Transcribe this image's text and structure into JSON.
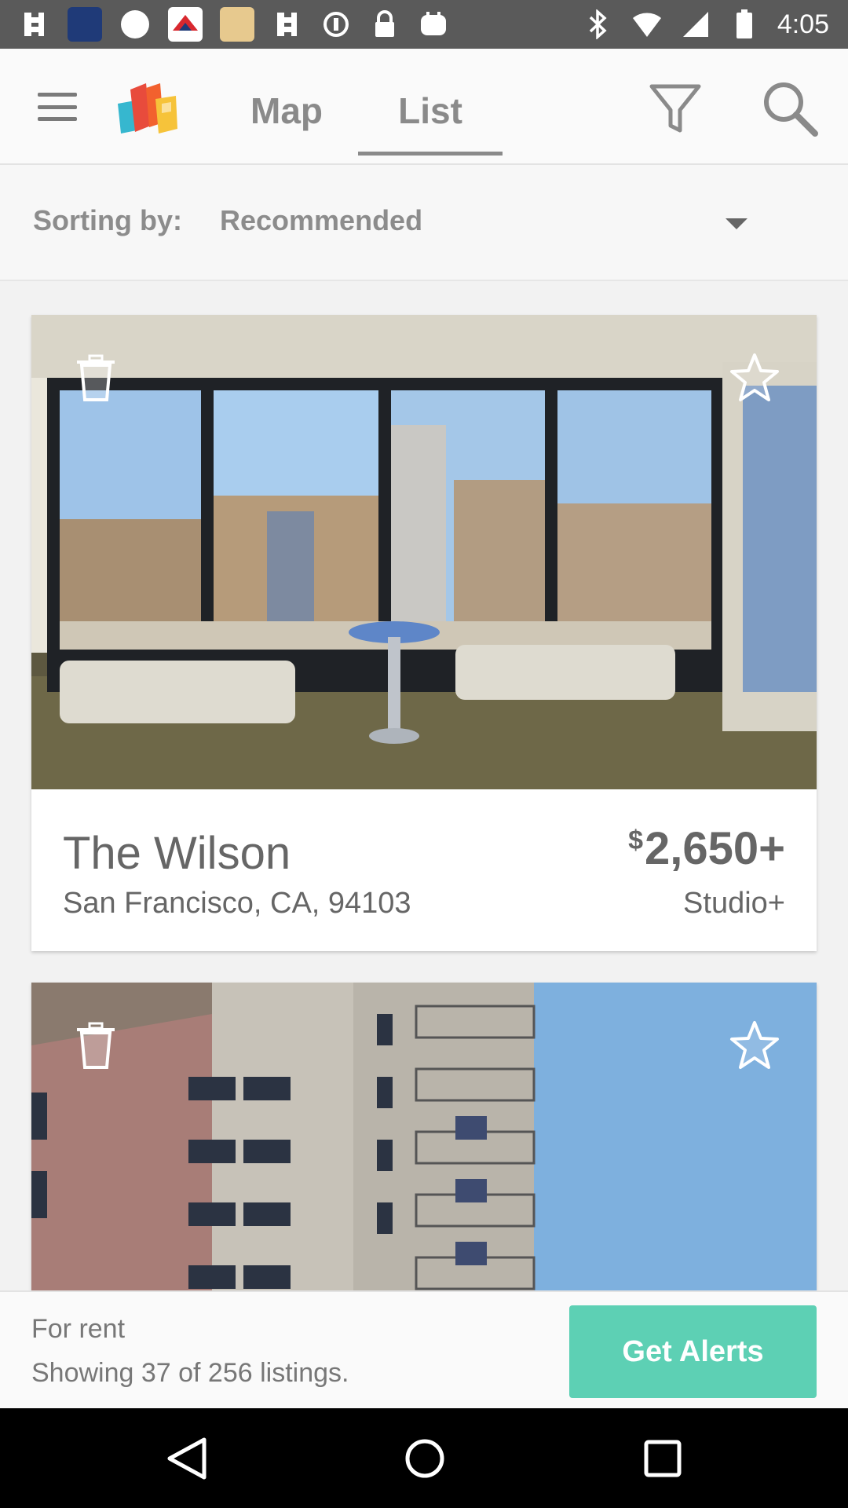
{
  "status_bar": {
    "time": "4:05"
  },
  "header": {
    "tabs": [
      {
        "label": "Map",
        "active": false
      },
      {
        "label": "List",
        "active": true
      }
    ],
    "icons": [
      "menu-icon",
      "app-logo",
      "filter-icon",
      "search-icon"
    ]
  },
  "sort": {
    "label": "Sorting by:",
    "value": "Recommended"
  },
  "listings": [
    {
      "name": "The Wilson",
      "address": "San Francisco, CA, 94103",
      "price_symbol": "$",
      "price": "2,650+",
      "beds": "Studio+",
      "icons": [
        "trash-icon",
        "star-icon"
      ]
    },
    {
      "icons": [
        "trash-icon",
        "star-icon"
      ]
    }
  ],
  "footer": {
    "type": "For rent",
    "count": "Showing 37 of 256 listings.",
    "alerts_button": "Get Alerts"
  },
  "colors": {
    "accent": "#5dd0b4",
    "status_bar": "#5a5a5a",
    "nav_bar": "#000000"
  }
}
